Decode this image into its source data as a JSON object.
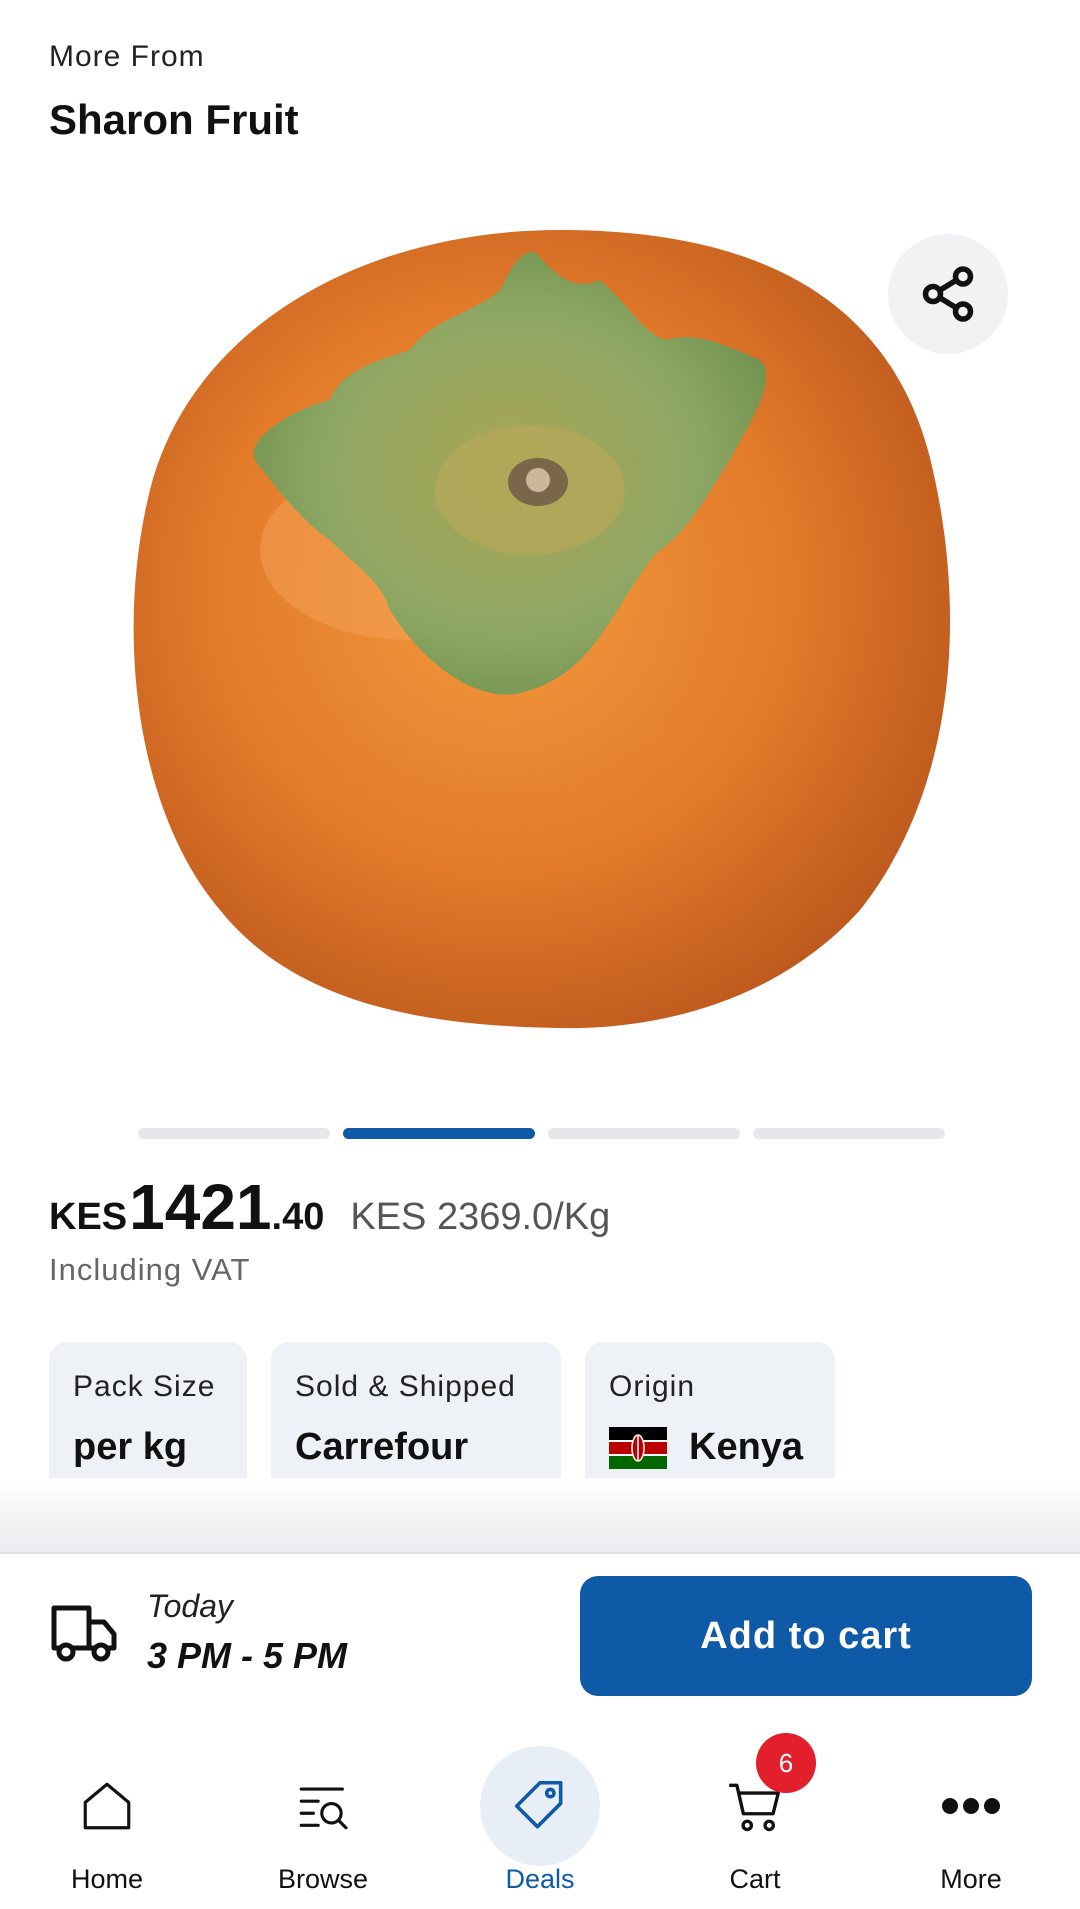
{
  "header": {
    "subtitle": "More From",
    "title": "Sharon Fruit"
  },
  "product_image": {
    "subject": "sharon fruit (persimmon)",
    "carousel_count": 4,
    "carousel_active_index": 1
  },
  "price": {
    "currency": "KES",
    "integer": "1421",
    "decimal": ".40",
    "unit_price": "KES 2369.0/Kg",
    "vat_note": "Including VAT"
  },
  "chips": [
    {
      "label": "Pack Size",
      "value": "per kg"
    },
    {
      "label": "Sold & Shipped",
      "value": "Carrefour"
    },
    {
      "label": "Origin",
      "value": "Kenya"
    }
  ],
  "delivery": {
    "day": "Today",
    "time": "3 PM - 5 PM"
  },
  "actions": {
    "add_to_cart": "Add to cart",
    "share_icon": "share-icon"
  },
  "nav": {
    "items": [
      {
        "label": "Home",
        "icon": "home-icon"
      },
      {
        "label": "Browse",
        "icon": "browse-icon"
      },
      {
        "label": "Deals",
        "icon": "tag-icon"
      },
      {
        "label": "Cart",
        "icon": "cart-icon"
      },
      {
        "label": "More",
        "icon": "more-icon"
      }
    ],
    "active": "Deals",
    "cart_badge": "6"
  },
  "colors": {
    "brand": "#0e5aa7",
    "badge": "#e21f2b",
    "chip_bg": "#eef1f5",
    "fruit": "#e0782a"
  }
}
